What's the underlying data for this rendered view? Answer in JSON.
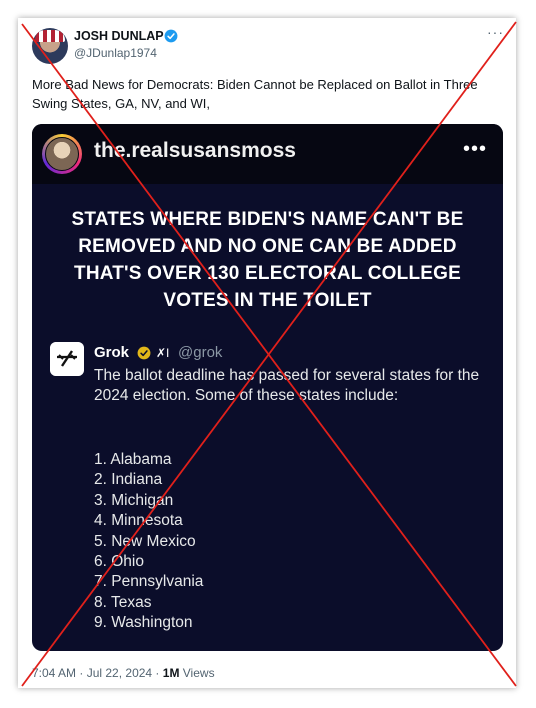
{
  "author": {
    "display_name": "JOSH DUNLAP",
    "handle": "@JDunlap1974"
  },
  "tweet": {
    "text": "More Bad News for Democrats: Biden Cannot be Replaced on Ballot in Three Swing States, GA, NV, and WI,"
  },
  "media": {
    "account_name": "the.realsusansmoss",
    "more_glyph": "•••",
    "headline": "STATES WHERE BIDEN'S NAME CAN'T BE REMOVED AND NO ONE CAN BE ADDED THAT'S OVER 130 ELECTORAL COLLEGE VOTES IN THE TOILET",
    "grok": {
      "name": "Grok",
      "x_glyph": "✗I",
      "handle": "@grok",
      "text": "The ballot deadline has passed for several states for the 2024 election. Some of these states include:",
      "states": [
        "1. Alabama",
        "2. Indiana",
        "3. Michigan",
        "4. Minnesota",
        "5. New Mexico",
        "6. Ohio",
        "7. Pennsylvania",
        "8. Texas",
        "9. Washington"
      ]
    }
  },
  "footer": {
    "time": "7:04 AM",
    "sep1": " · ",
    "date": "Jul 22, 2024",
    "sep2": " · ",
    "views_count": "1M",
    "views_label": " Views"
  },
  "colors": {
    "verified_blue": "#1d9bf0",
    "grok_gold": "#e2b719",
    "cross_red": "#e0201b",
    "media_bg": "#0b0d2a"
  },
  "more_glyph": "···"
}
